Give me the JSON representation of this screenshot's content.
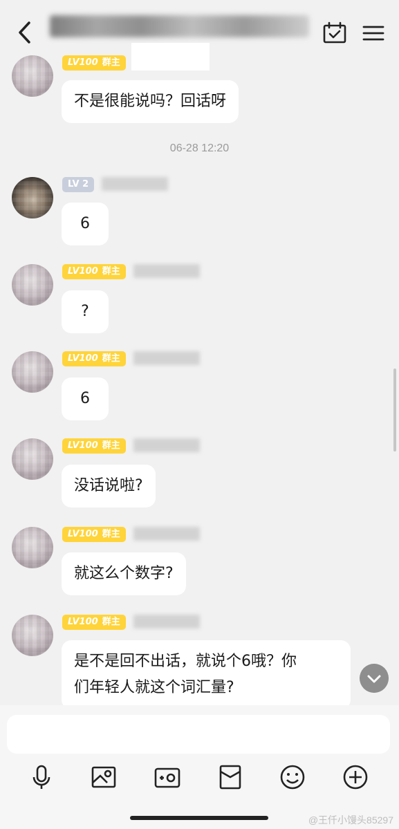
{
  "colors": {
    "background": "#f1f1f1",
    "badge_owner": "#ffd43a",
    "badge_member": "#c8cedc",
    "bubble": "#ffffff"
  },
  "header": {
    "back_icon": "chevron-left-icon",
    "calendar_icon": "calendar-check-icon",
    "menu_icon": "hamburger-menu-icon"
  },
  "timestamp": "06-28 12:20",
  "badges": {
    "level": "LV100",
    "role": "群主",
    "member_level": "LV 2"
  },
  "messages": [
    {
      "text": "不是很能说吗？回话呀"
    },
    {
      "text": "6"
    },
    {
      "text": "?"
    },
    {
      "text": "6"
    },
    {
      "text": "没话说啦?"
    },
    {
      "text": "就这么个数字?"
    },
    {
      "text": "是不是回不出话，就说个6哦？你\n们年轻人就这个词汇量?"
    }
  ],
  "toolbar": {
    "icons": [
      "microphone-icon",
      "image-icon",
      "camera-icon",
      "red-packet-icon",
      "emoji-icon",
      "plus-icon"
    ]
  },
  "watermark": "@王仟小馒头85297"
}
